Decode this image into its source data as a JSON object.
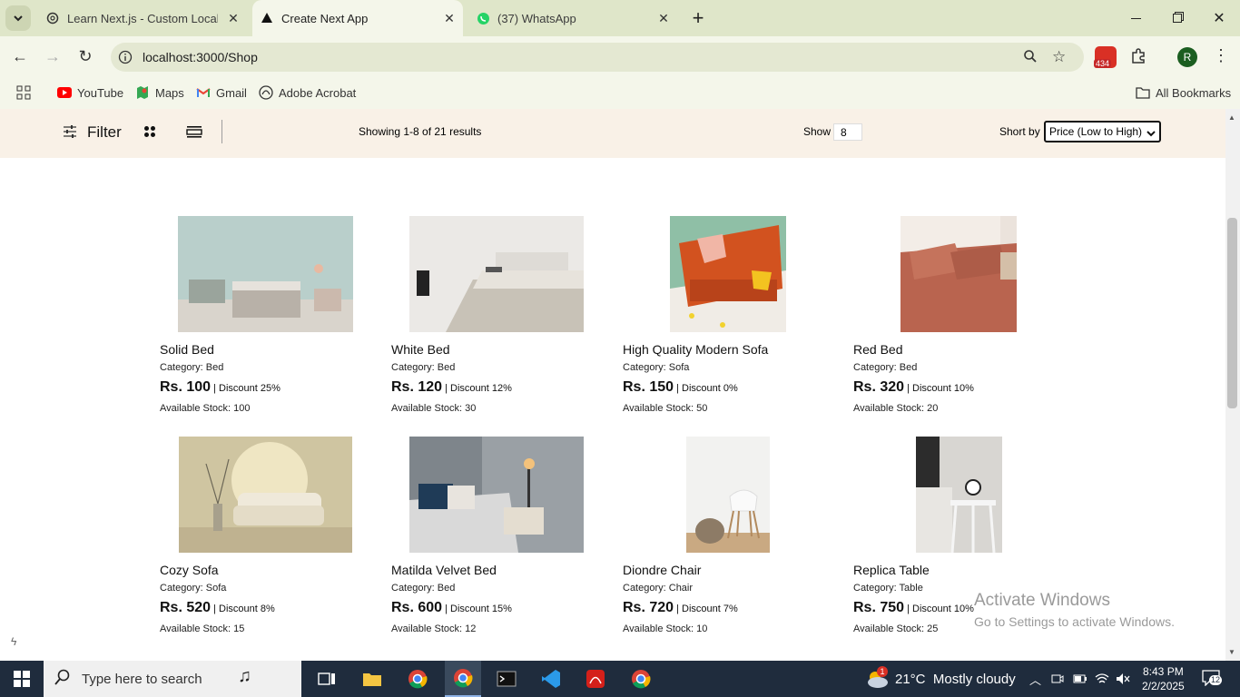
{
  "browser": {
    "tabs": [
      {
        "title": "Learn Next.js - Custom Localho",
        "icon": "openai-icon",
        "active": false
      },
      {
        "title": "Create Next App",
        "icon": "nextjs-icon",
        "active": true
      },
      {
        "title": "(37) WhatsApp",
        "icon": "whatsapp-icon",
        "active": false
      }
    ],
    "url": "localhost:3000/Shop",
    "extension_badge": "434",
    "profile_initial": "R",
    "bookmarks": [
      {
        "label": "YouTube",
        "icon": "youtube-icon"
      },
      {
        "label": "Maps",
        "icon": "maps-icon"
      },
      {
        "label": "Gmail",
        "icon": "gmail-icon"
      },
      {
        "label": "Adobe Acrobat",
        "icon": "acrobat-icon"
      }
    ],
    "all_bookmarks_label": "All Bookmarks"
  },
  "shop": {
    "filter_label": "Filter",
    "results_text": "Showing 1-8 of 21 results",
    "show_label": "Show",
    "show_value": "8",
    "sort_label": "Short by",
    "sort_selected": "Price (Low to High)",
    "products": [
      {
        "name": "Solid Bed",
        "category": "Category: Bed",
        "price": "Rs. 100",
        "discount": " | Discount 25%",
        "stock": "Available Stock: 100"
      },
      {
        "name": "White Bed",
        "category": "Category: Bed",
        "price": "Rs. 120",
        "discount": " | Discount 12%",
        "stock": "Available Stock: 30"
      },
      {
        "name": "High Quality Modern Sofa",
        "category": "Category: Sofa",
        "price": "Rs. 150",
        "discount": " | Discount 0%",
        "stock": "Available Stock: 50"
      },
      {
        "name": "Red Bed",
        "category": "Category: Bed",
        "price": "Rs. 320",
        "discount": " | Discount 10%",
        "stock": "Available Stock: 20"
      },
      {
        "name": "Cozy Sofa",
        "category": "Category: Sofa",
        "price": "Rs. 520",
        "discount": " | Discount 8%",
        "stock": "Available Stock: 15"
      },
      {
        "name": "Matilda Velvet Bed",
        "category": "Category: Bed",
        "price": "Rs. 600",
        "discount": " | Discount 15%",
        "stock": "Available Stock: 12"
      },
      {
        "name": "Diondre Chair",
        "category": "Category: Chair",
        "price": "Rs. 720",
        "discount": " | Discount 7%",
        "stock": "Available Stock: 10"
      },
      {
        "name": "Replica Table",
        "category": "Category: Table",
        "price": "Rs. 750",
        "discount": " | Discount 10%",
        "stock": "Available Stock: 25"
      }
    ]
  },
  "watermark": {
    "line1": "Activate Windows",
    "line2": "Go to Settings to activate Windows."
  },
  "taskbar": {
    "search_placeholder": "Type here to search",
    "weather": "21°C  Mostly cloudy",
    "weather_badge": "1",
    "time": "8:43 PM",
    "date": "2/2/2025",
    "notification_count": "12"
  },
  "colors": {
    "tabstrip": "#dfe6c9",
    "toolbar": "#f4f6ea",
    "filterbar": "#f9f1e7",
    "taskbar": "#1f2c3d"
  }
}
